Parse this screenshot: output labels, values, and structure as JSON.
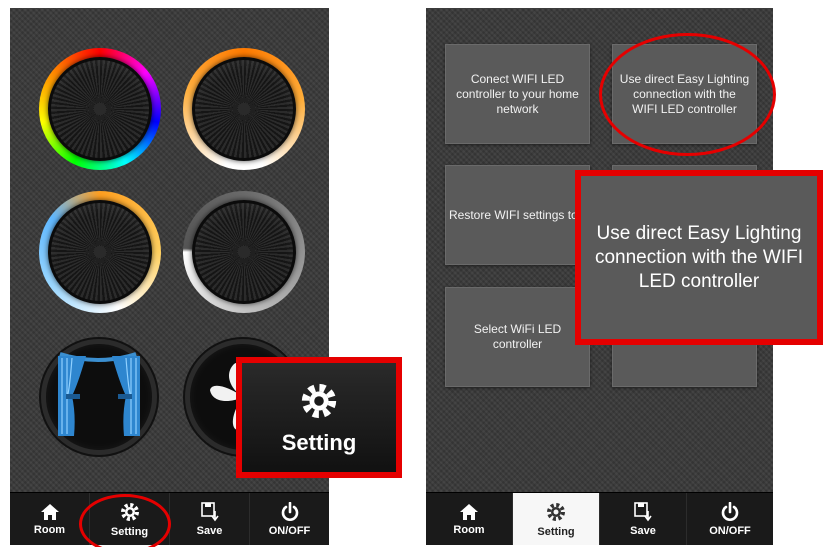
{
  "left_screen": {
    "controls": {
      "rgb_knob": "rgb-color-knob",
      "warm_knob": "warm-white-knob",
      "cct_knob": "color-temperature-knob",
      "dim_knob": "brightness-knob",
      "curtain": "curtain-icon",
      "fan": "fan-icon"
    },
    "callout": {
      "label": "Setting",
      "icon": "gear-icon"
    },
    "nav": [
      {
        "label": "Room",
        "icon": "home-icon"
      },
      {
        "label": "Setting",
        "icon": "gear-icon"
      },
      {
        "label": "Save",
        "icon": "save-icon"
      },
      {
        "label": "ON/OFF",
        "icon": "power-icon"
      }
    ]
  },
  "right_screen": {
    "tiles": {
      "connect": "Conect WIFI LED controller to your home network",
      "direct": "Use direct Easy Lighting connection with the WIFI LED controller",
      "restore": "Restore WIFI settings to factory default settin",
      "select": "Select WiFi LED controller"
    },
    "callout": {
      "text": "Use direct Easy Lighting connection with the WIFI LED controller"
    },
    "nav": [
      {
        "label": "Room",
        "icon": "home-icon"
      },
      {
        "label": "Setting",
        "icon": "gear-icon",
        "active": true
      },
      {
        "label": "Save",
        "icon": "save-icon"
      },
      {
        "label": "ON/OFF",
        "icon": "power-icon"
      }
    ]
  },
  "colors": {
    "highlight": "#e50000",
    "tile": "#5a5a5a",
    "nav_bg": "#1a1a1a",
    "active_tab": "#f7f7f7"
  }
}
